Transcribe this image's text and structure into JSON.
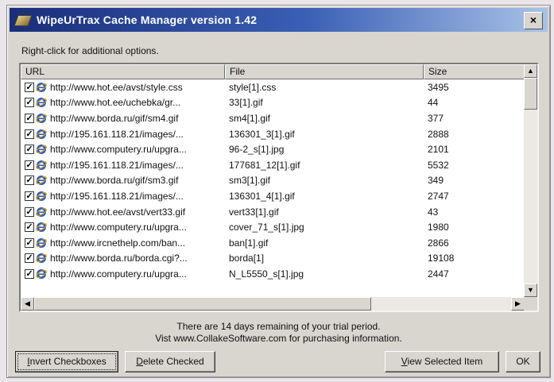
{
  "window": {
    "title": "WipeUrTrax Cache Manager version 1.42",
    "close_label": "×"
  },
  "hint": "Right-click for additional options.",
  "list": {
    "columns": [
      "URL",
      "File",
      "Size"
    ],
    "rows": [
      {
        "url": "http://www.hot.ee/avst/style.css",
        "file": "style[1].css",
        "size": "3495",
        "checked": true
      },
      {
        "url": "http://www.hot.ee/uchebka/gr...",
        "file": "33[1].gif",
        "size": "44",
        "checked": true
      },
      {
        "url": "http://www.borda.ru/gif/sm4.gif",
        "file": "sm4[1].gif",
        "size": "377",
        "checked": true
      },
      {
        "url": "http://195.161.118.21/images/...",
        "file": "136301_3[1].gif",
        "size": "2888",
        "checked": true
      },
      {
        "url": "http://www.computery.ru/upgra...",
        "file": "96-2_s[1].jpg",
        "size": "2101",
        "checked": true
      },
      {
        "url": "http://195.161.118.21/images/...",
        "file": "177681_12[1].gif",
        "size": "5532",
        "checked": true
      },
      {
        "url": "http://www.borda.ru/gif/sm3.gif",
        "file": "sm3[1].gif",
        "size": "349",
        "checked": true
      },
      {
        "url": "http://195.161.118.21/images/...",
        "file": "136301_4[1].gif",
        "size": "2747",
        "checked": true
      },
      {
        "url": "http://www.hot.ee/avst/vert33.gif",
        "file": "vert33[1].gif",
        "size": "43",
        "checked": true
      },
      {
        "url": "http://www.computery.ru/upgra...",
        "file": "cover_71_s[1].jpg",
        "size": "1980",
        "checked": true
      },
      {
        "url": "http://www.ircnethelp.com/ban...",
        "file": "ban[1].gif",
        "size": "2866",
        "checked": true
      },
      {
        "url": "http://www.borda.ru/borda.cgi?...",
        "file": "borda[1]",
        "size": "19108",
        "checked": true
      },
      {
        "url": "http://www.computery.ru/upgra...",
        "file": "N_L5550_s[1].jpg",
        "size": "2447",
        "checked": true
      }
    ]
  },
  "trial": {
    "line1": "There are 14 days remaining of your trial period.",
    "line2": "Vist www.CollakeSoftware.com for purchasing information."
  },
  "buttons": {
    "invert": {
      "underline": "I",
      "rest": "nvert Checkboxes"
    },
    "delete": {
      "underline": "D",
      "rest": "elete Checked"
    },
    "view": {
      "underline": "V",
      "rest": "iew Selected Item"
    },
    "ok": "OK"
  },
  "icons": {
    "checkbox": "checked-checkbox-icon",
    "row": "internet-explorer-icon",
    "app": "brush-icon"
  }
}
